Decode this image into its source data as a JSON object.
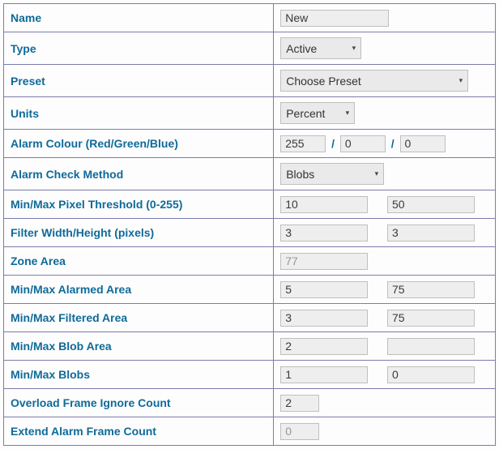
{
  "rows": {
    "name": {
      "label": "Name",
      "value": "New"
    },
    "type": {
      "label": "Type",
      "value": "Active"
    },
    "preset": {
      "label": "Preset",
      "value": "Choose Preset"
    },
    "units": {
      "label": "Units",
      "value": "Percent"
    },
    "alarm_colour": {
      "label": "Alarm Colour (Red/Green/Blue)",
      "r": "255",
      "g": "0",
      "b": "0"
    },
    "alarm_method": {
      "label": "Alarm Check Method",
      "value": "Blobs"
    },
    "pixel_thresh": {
      "label": "Min/Max Pixel Threshold (0-255)",
      "min": "10",
      "max": "50"
    },
    "filter_wh": {
      "label": "Filter Width/Height (pixels)",
      "w": "3",
      "h": "3"
    },
    "zone_area": {
      "label": "Zone Area",
      "value": "77"
    },
    "alarmed_area": {
      "label": "Min/Max Alarmed Area",
      "min": "5",
      "max": "75"
    },
    "filtered_area": {
      "label": "Min/Max Filtered Area",
      "min": "3",
      "max": "75"
    },
    "blob_area": {
      "label": "Min/Max Blob Area",
      "min": "2",
      "max": ""
    },
    "blobs": {
      "label": "Min/Max Blobs",
      "min": "1",
      "max": "0"
    },
    "overload": {
      "label": "Overload Frame Ignore Count",
      "value": "2"
    },
    "extend": {
      "label": "Extend Alarm Frame Count",
      "value": "0"
    }
  }
}
